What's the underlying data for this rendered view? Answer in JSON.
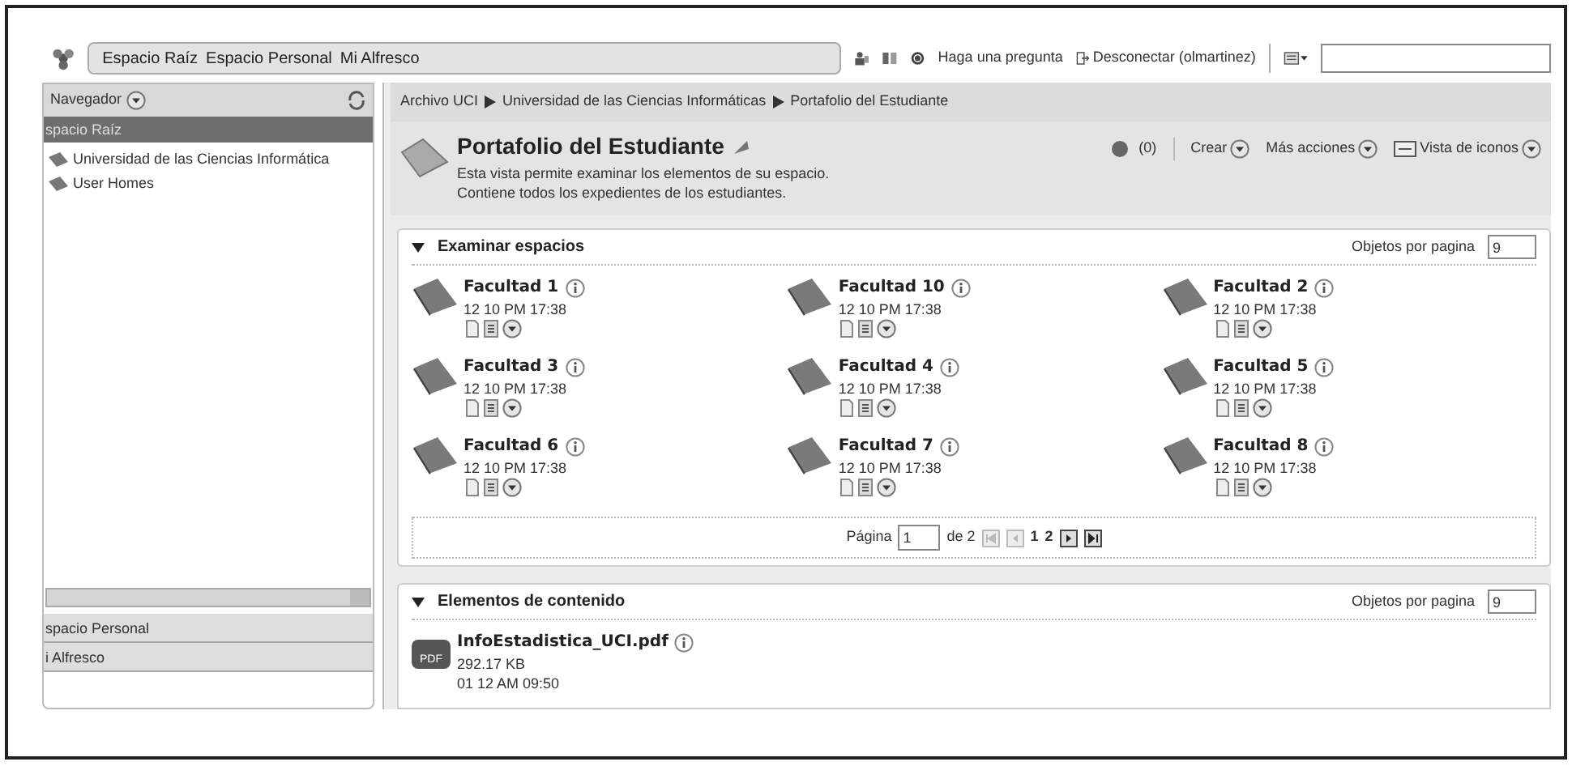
{
  "top_bar": {
    "links": [
      "Espacio Raíz",
      "Espacio Personal",
      "Mi Alfresco"
    ],
    "help": "Haga una pregunta",
    "logout": "Desconectar (olmartinez)"
  },
  "navigator": {
    "title": "Navegador",
    "sections": [
      {
        "label": "spacio Raíz",
        "selected": true,
        "tree": [
          "Universidad de las Ciencias Informática",
          "User Homes"
        ]
      },
      {
        "label": "spacio Personal",
        "selected": false
      },
      {
        "label": "i Alfresco",
        "selected": false
      }
    ]
  },
  "breadcrumb": [
    "Archivo UCI",
    "Universidad de las Ciencias Informáticas",
    "Portafolio del Estudiante"
  ],
  "header": {
    "title": "Portafolio del Estudiante",
    "description": [
      "Esta vista permite examinar los elementos de su espacio.",
      "Contiene todos los expedientes de los estudiantes."
    ],
    "count": "(0)",
    "actions": [
      "Crear",
      "Más acciones",
      "Vista de iconos"
    ]
  },
  "spaces_panel": {
    "title": "Examinar espacios",
    "per_page_label": "Objetos por pagina",
    "per_page": "9",
    "items": [
      {
        "name": "Facultad 1",
        "date": "12 10 PM 17:38"
      },
      {
        "name": "Facultad 10",
        "date": "12 10 PM 17:38"
      },
      {
        "name": "Facultad 2",
        "date": "12 10 PM 17:38"
      },
      {
        "name": "Facultad 3",
        "date": "12 10 PM 17:38"
      },
      {
        "name": "Facultad 4",
        "date": "12 10 PM 17:38"
      },
      {
        "name": "Facultad 5",
        "date": "12 10 PM 17:38"
      },
      {
        "name": "Facultad 6",
        "date": "12 10 PM 17:38"
      },
      {
        "name": "Facultad 7",
        "date": "12 10 PM 17:38"
      },
      {
        "name": "Facultad 8",
        "date": "12 10 PM 17:38"
      }
    ],
    "pagination": {
      "label": "Página",
      "page": "1",
      "of": "de 2",
      "pages": [
        "1",
        "2"
      ]
    }
  },
  "content_panel": {
    "title": "Elementos de contenido",
    "per_page_label": "Objetos por pagina",
    "per_page": "9",
    "items": [
      {
        "name": "InfoEstadistica_UCI.pdf",
        "badge": "PDF",
        "size": "292.17 KB",
        "date": "01 12 AM 09:50"
      }
    ]
  }
}
